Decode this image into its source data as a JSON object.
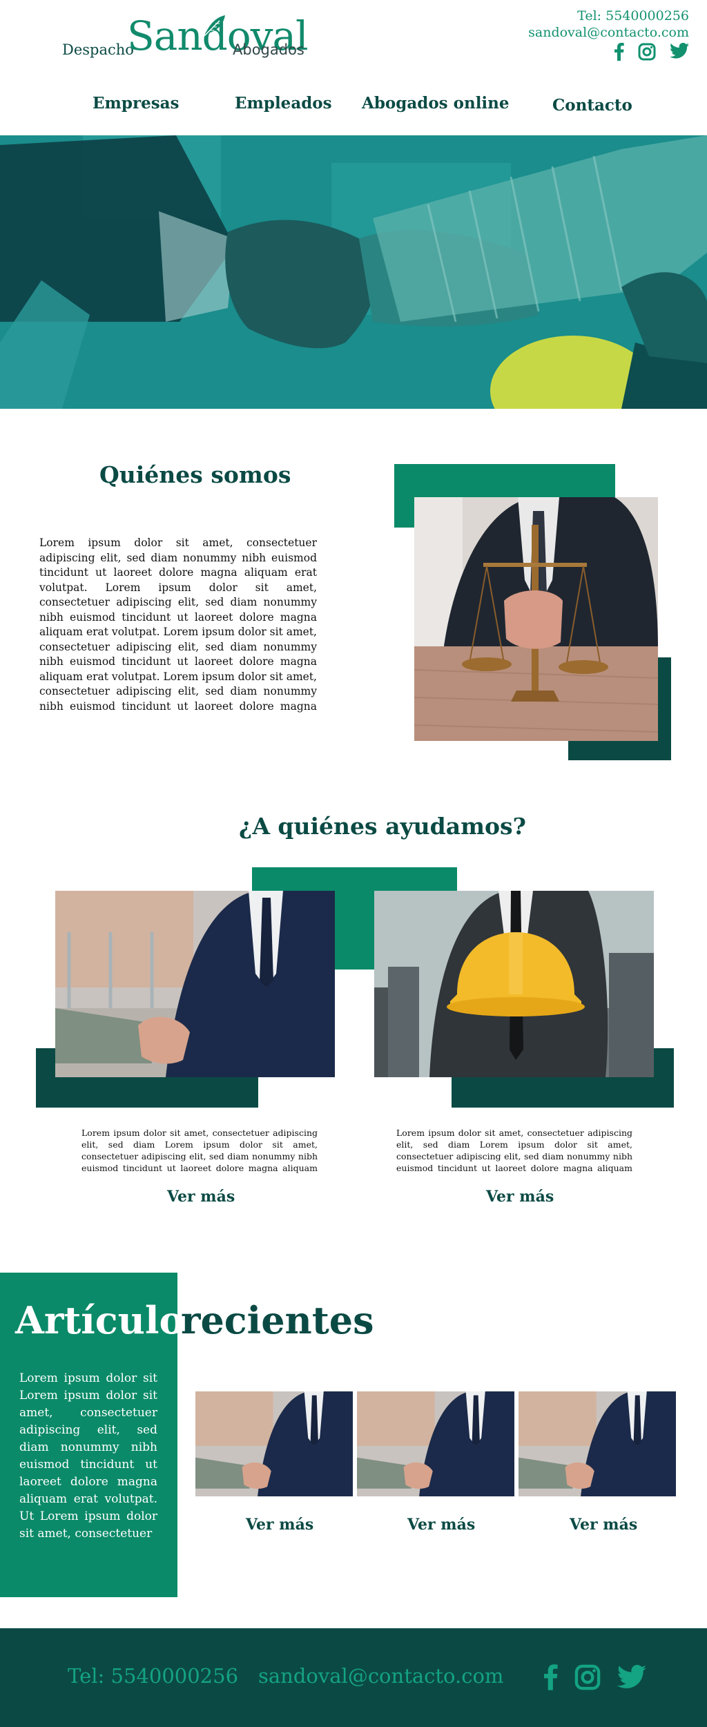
{
  "header": {
    "logo_prefix": "Despacho",
    "logo_name": "Sandoval",
    "logo_suffix": "Abogados",
    "phone": "Tel: 5540000256",
    "email": "sandoval@contacto.com"
  },
  "nav": {
    "items": [
      "Empresas",
      "Empleados",
      "Abogados online",
      "Contacto"
    ]
  },
  "about": {
    "title": "Quiénes somos",
    "text": "Lorem ipsum dolor sit amet, consectetuer adipiscing elit, sed diam nonummy nibh euismod tincidunt ut laoreet dolore magna aliquam erat volutpat. Lorem ipsum dolor sit amet, consectetuer adipiscing elit, sed diam nonummy nibh euismod tincidunt ut laoreet dolore magna aliquam erat volutpat. Lorem ipsum dolor sit amet, consectetuer adipiscing elit, sed diam nonummy nibh euismod tincidunt ut laoreet dolore magna aliquam erat volutpat. Lorem ipsum dolor sit amet, consectetuer adipiscing elit, sed diam nonummy nibh euismod tincidunt ut laoreet dolore magna aliquam erat volutpat. Lorem ipsum dolor sit amet, con-"
  },
  "help": {
    "title": "¿A quiénes ayudamos?",
    "cards": [
      {
        "text": "Lorem ipsum dolor sit amet, consectetuer adipiscing elit, sed diam Lorem ipsum dolor sit amet, consectetuer adipiscing elit, sed diam nonummy nibh euismod tincidunt ut laoreet dolore magna aliquam erat volutpat. Ut wisi enim",
        "link": "Ver más"
      },
      {
        "text": "Lorem ipsum dolor sit amet, consectetuer adipiscing elit, sed diam Lorem ipsum dolor sit amet, consectetuer adipiscing elit, sed diam nonummy nibh euismod tincidunt ut laoreet dolore magna aliquam erat volutpat. Ut wisi enim",
        "link": "Ver más"
      }
    ]
  },
  "articles": {
    "title_left": "Artículos",
    "title_right": "recientes",
    "text": "Lorem ipsum dolor sit Lorem ipsum dolor sit amet, consectetuer adipiscing elit, sed diam nonummy nibh euismod tincidunt ut laoreet dolore magna aliquam erat volutpat. Ut Lorem ipsum dolor sit amet, consectetuer",
    "items": [
      {
        "link": "Ver más"
      },
      {
        "link": "Ver más"
      },
      {
        "link": "Ver más"
      }
    ]
  },
  "footer": {
    "phone": "Tel: 5540000256",
    "email": "sandoval@contacto.com"
  },
  "icons": {
    "social": [
      "facebook-icon",
      "instagram-icon",
      "twitter-icon"
    ],
    "logo": "quill-leaf-icon"
  },
  "colors": {
    "primary_green": "#0a8a68",
    "dark_green": "#0b4a44",
    "accent_text": "#12916f"
  }
}
